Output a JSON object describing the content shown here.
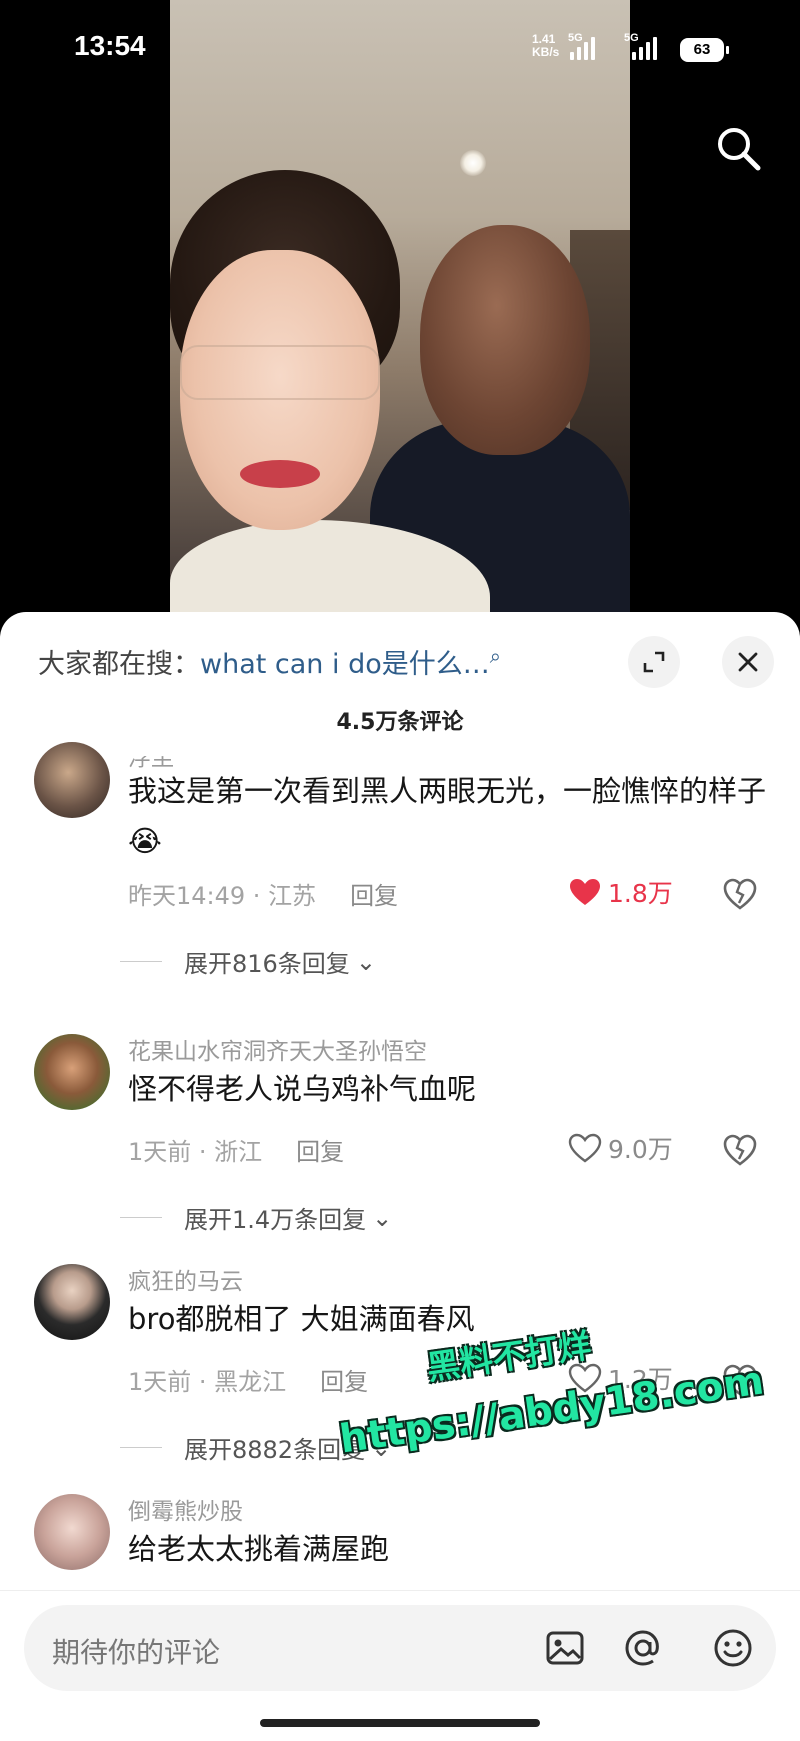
{
  "status_bar": {
    "time": "13:54",
    "net_speed_value": "1.41",
    "net_speed_unit": "KB/s",
    "network_1": "5G",
    "network_2": "5G",
    "battery": "63"
  },
  "sheet": {
    "search_prefix": "大家都在搜：",
    "search_query": "what can i do是什么…",
    "comment_count": "4.5万条评论"
  },
  "comments": [
    {
      "username": "浮尘",
      "text": "我这是第一次看到黑人两眼无光，一脸憔悴的样子😭",
      "time": "昨天14:49",
      "location": "江苏",
      "reply_label": "回复",
      "likes": "1.8万",
      "liked": true,
      "expand_label": "展开816条回复"
    },
    {
      "username": "花果山水帘洞齐天大圣孙悟空",
      "text": "怪不得老人说乌鸡补气血呢",
      "time": "1天前",
      "location": "浙江",
      "reply_label": "回复",
      "likes": "9.0万",
      "liked": false,
      "expand_label": "展开1.4万条回复"
    },
    {
      "username": "疯狂的马云",
      "text": "bro都脱相了 大姐满面春风",
      "time": "1天前",
      "location": "黑龙江",
      "reply_label": "回复",
      "likes": "1.2万",
      "liked": false,
      "expand_label": "展开8882条回复"
    },
    {
      "username": "倒霉熊炒股",
      "text": "给老太太挑着满屋跑"
    }
  ],
  "watermark": {
    "line1": "黑料不打烊",
    "line2": "https://abdy18.com"
  },
  "input": {
    "placeholder": "期待你的评论"
  },
  "colors": {
    "like_red": "#e8344a",
    "link_blue": "#2f5d8a",
    "watermark_green": "#22e6a2"
  }
}
